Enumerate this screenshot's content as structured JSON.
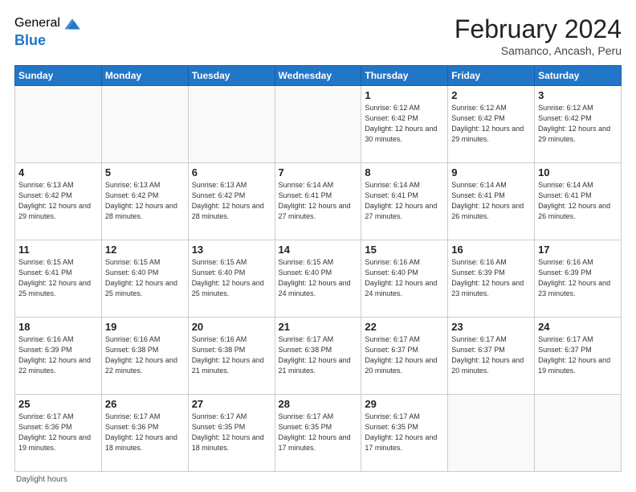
{
  "header": {
    "logo_general": "General",
    "logo_blue": "Blue",
    "month_title": "February 2024",
    "location": "Samanco, Ancash, Peru"
  },
  "days_of_week": [
    "Sunday",
    "Monday",
    "Tuesday",
    "Wednesday",
    "Thursday",
    "Friday",
    "Saturday"
  ],
  "footer_text": "Daylight hours",
  "weeks": [
    [
      {
        "day": "",
        "detail": ""
      },
      {
        "day": "",
        "detail": ""
      },
      {
        "day": "",
        "detail": ""
      },
      {
        "day": "",
        "detail": ""
      },
      {
        "day": "1",
        "detail": "Sunrise: 6:12 AM\nSunset: 6:42 PM\nDaylight: 12 hours\nand 30 minutes."
      },
      {
        "day": "2",
        "detail": "Sunrise: 6:12 AM\nSunset: 6:42 PM\nDaylight: 12 hours\nand 29 minutes."
      },
      {
        "day": "3",
        "detail": "Sunrise: 6:12 AM\nSunset: 6:42 PM\nDaylight: 12 hours\nand 29 minutes."
      }
    ],
    [
      {
        "day": "4",
        "detail": "Sunrise: 6:13 AM\nSunset: 6:42 PM\nDaylight: 12 hours\nand 29 minutes."
      },
      {
        "day": "5",
        "detail": "Sunrise: 6:13 AM\nSunset: 6:42 PM\nDaylight: 12 hours\nand 28 minutes."
      },
      {
        "day": "6",
        "detail": "Sunrise: 6:13 AM\nSunset: 6:42 PM\nDaylight: 12 hours\nand 28 minutes."
      },
      {
        "day": "7",
        "detail": "Sunrise: 6:14 AM\nSunset: 6:41 PM\nDaylight: 12 hours\nand 27 minutes."
      },
      {
        "day": "8",
        "detail": "Sunrise: 6:14 AM\nSunset: 6:41 PM\nDaylight: 12 hours\nand 27 minutes."
      },
      {
        "day": "9",
        "detail": "Sunrise: 6:14 AM\nSunset: 6:41 PM\nDaylight: 12 hours\nand 26 minutes."
      },
      {
        "day": "10",
        "detail": "Sunrise: 6:14 AM\nSunset: 6:41 PM\nDaylight: 12 hours\nand 26 minutes."
      }
    ],
    [
      {
        "day": "11",
        "detail": "Sunrise: 6:15 AM\nSunset: 6:41 PM\nDaylight: 12 hours\nand 25 minutes."
      },
      {
        "day": "12",
        "detail": "Sunrise: 6:15 AM\nSunset: 6:40 PM\nDaylight: 12 hours\nand 25 minutes."
      },
      {
        "day": "13",
        "detail": "Sunrise: 6:15 AM\nSunset: 6:40 PM\nDaylight: 12 hours\nand 25 minutes."
      },
      {
        "day": "14",
        "detail": "Sunrise: 6:15 AM\nSunset: 6:40 PM\nDaylight: 12 hours\nand 24 minutes."
      },
      {
        "day": "15",
        "detail": "Sunrise: 6:16 AM\nSunset: 6:40 PM\nDaylight: 12 hours\nand 24 minutes."
      },
      {
        "day": "16",
        "detail": "Sunrise: 6:16 AM\nSunset: 6:39 PM\nDaylight: 12 hours\nand 23 minutes."
      },
      {
        "day": "17",
        "detail": "Sunrise: 6:16 AM\nSunset: 6:39 PM\nDaylight: 12 hours\nand 23 minutes."
      }
    ],
    [
      {
        "day": "18",
        "detail": "Sunrise: 6:16 AM\nSunset: 6:39 PM\nDaylight: 12 hours\nand 22 minutes."
      },
      {
        "day": "19",
        "detail": "Sunrise: 6:16 AM\nSunset: 6:38 PM\nDaylight: 12 hours\nand 22 minutes."
      },
      {
        "day": "20",
        "detail": "Sunrise: 6:16 AM\nSunset: 6:38 PM\nDaylight: 12 hours\nand 21 minutes."
      },
      {
        "day": "21",
        "detail": "Sunrise: 6:17 AM\nSunset: 6:38 PM\nDaylight: 12 hours\nand 21 minutes."
      },
      {
        "day": "22",
        "detail": "Sunrise: 6:17 AM\nSunset: 6:37 PM\nDaylight: 12 hours\nand 20 minutes."
      },
      {
        "day": "23",
        "detail": "Sunrise: 6:17 AM\nSunset: 6:37 PM\nDaylight: 12 hours\nand 20 minutes."
      },
      {
        "day": "24",
        "detail": "Sunrise: 6:17 AM\nSunset: 6:37 PM\nDaylight: 12 hours\nand 19 minutes."
      }
    ],
    [
      {
        "day": "25",
        "detail": "Sunrise: 6:17 AM\nSunset: 6:36 PM\nDaylight: 12 hours\nand 19 minutes."
      },
      {
        "day": "26",
        "detail": "Sunrise: 6:17 AM\nSunset: 6:36 PM\nDaylight: 12 hours\nand 18 minutes."
      },
      {
        "day": "27",
        "detail": "Sunrise: 6:17 AM\nSunset: 6:35 PM\nDaylight: 12 hours\nand 18 minutes."
      },
      {
        "day": "28",
        "detail": "Sunrise: 6:17 AM\nSunset: 6:35 PM\nDaylight: 12 hours\nand 17 minutes."
      },
      {
        "day": "29",
        "detail": "Sunrise: 6:17 AM\nSunset: 6:35 PM\nDaylight: 12 hours\nand 17 minutes."
      },
      {
        "day": "",
        "detail": ""
      },
      {
        "day": "",
        "detail": ""
      }
    ]
  ]
}
